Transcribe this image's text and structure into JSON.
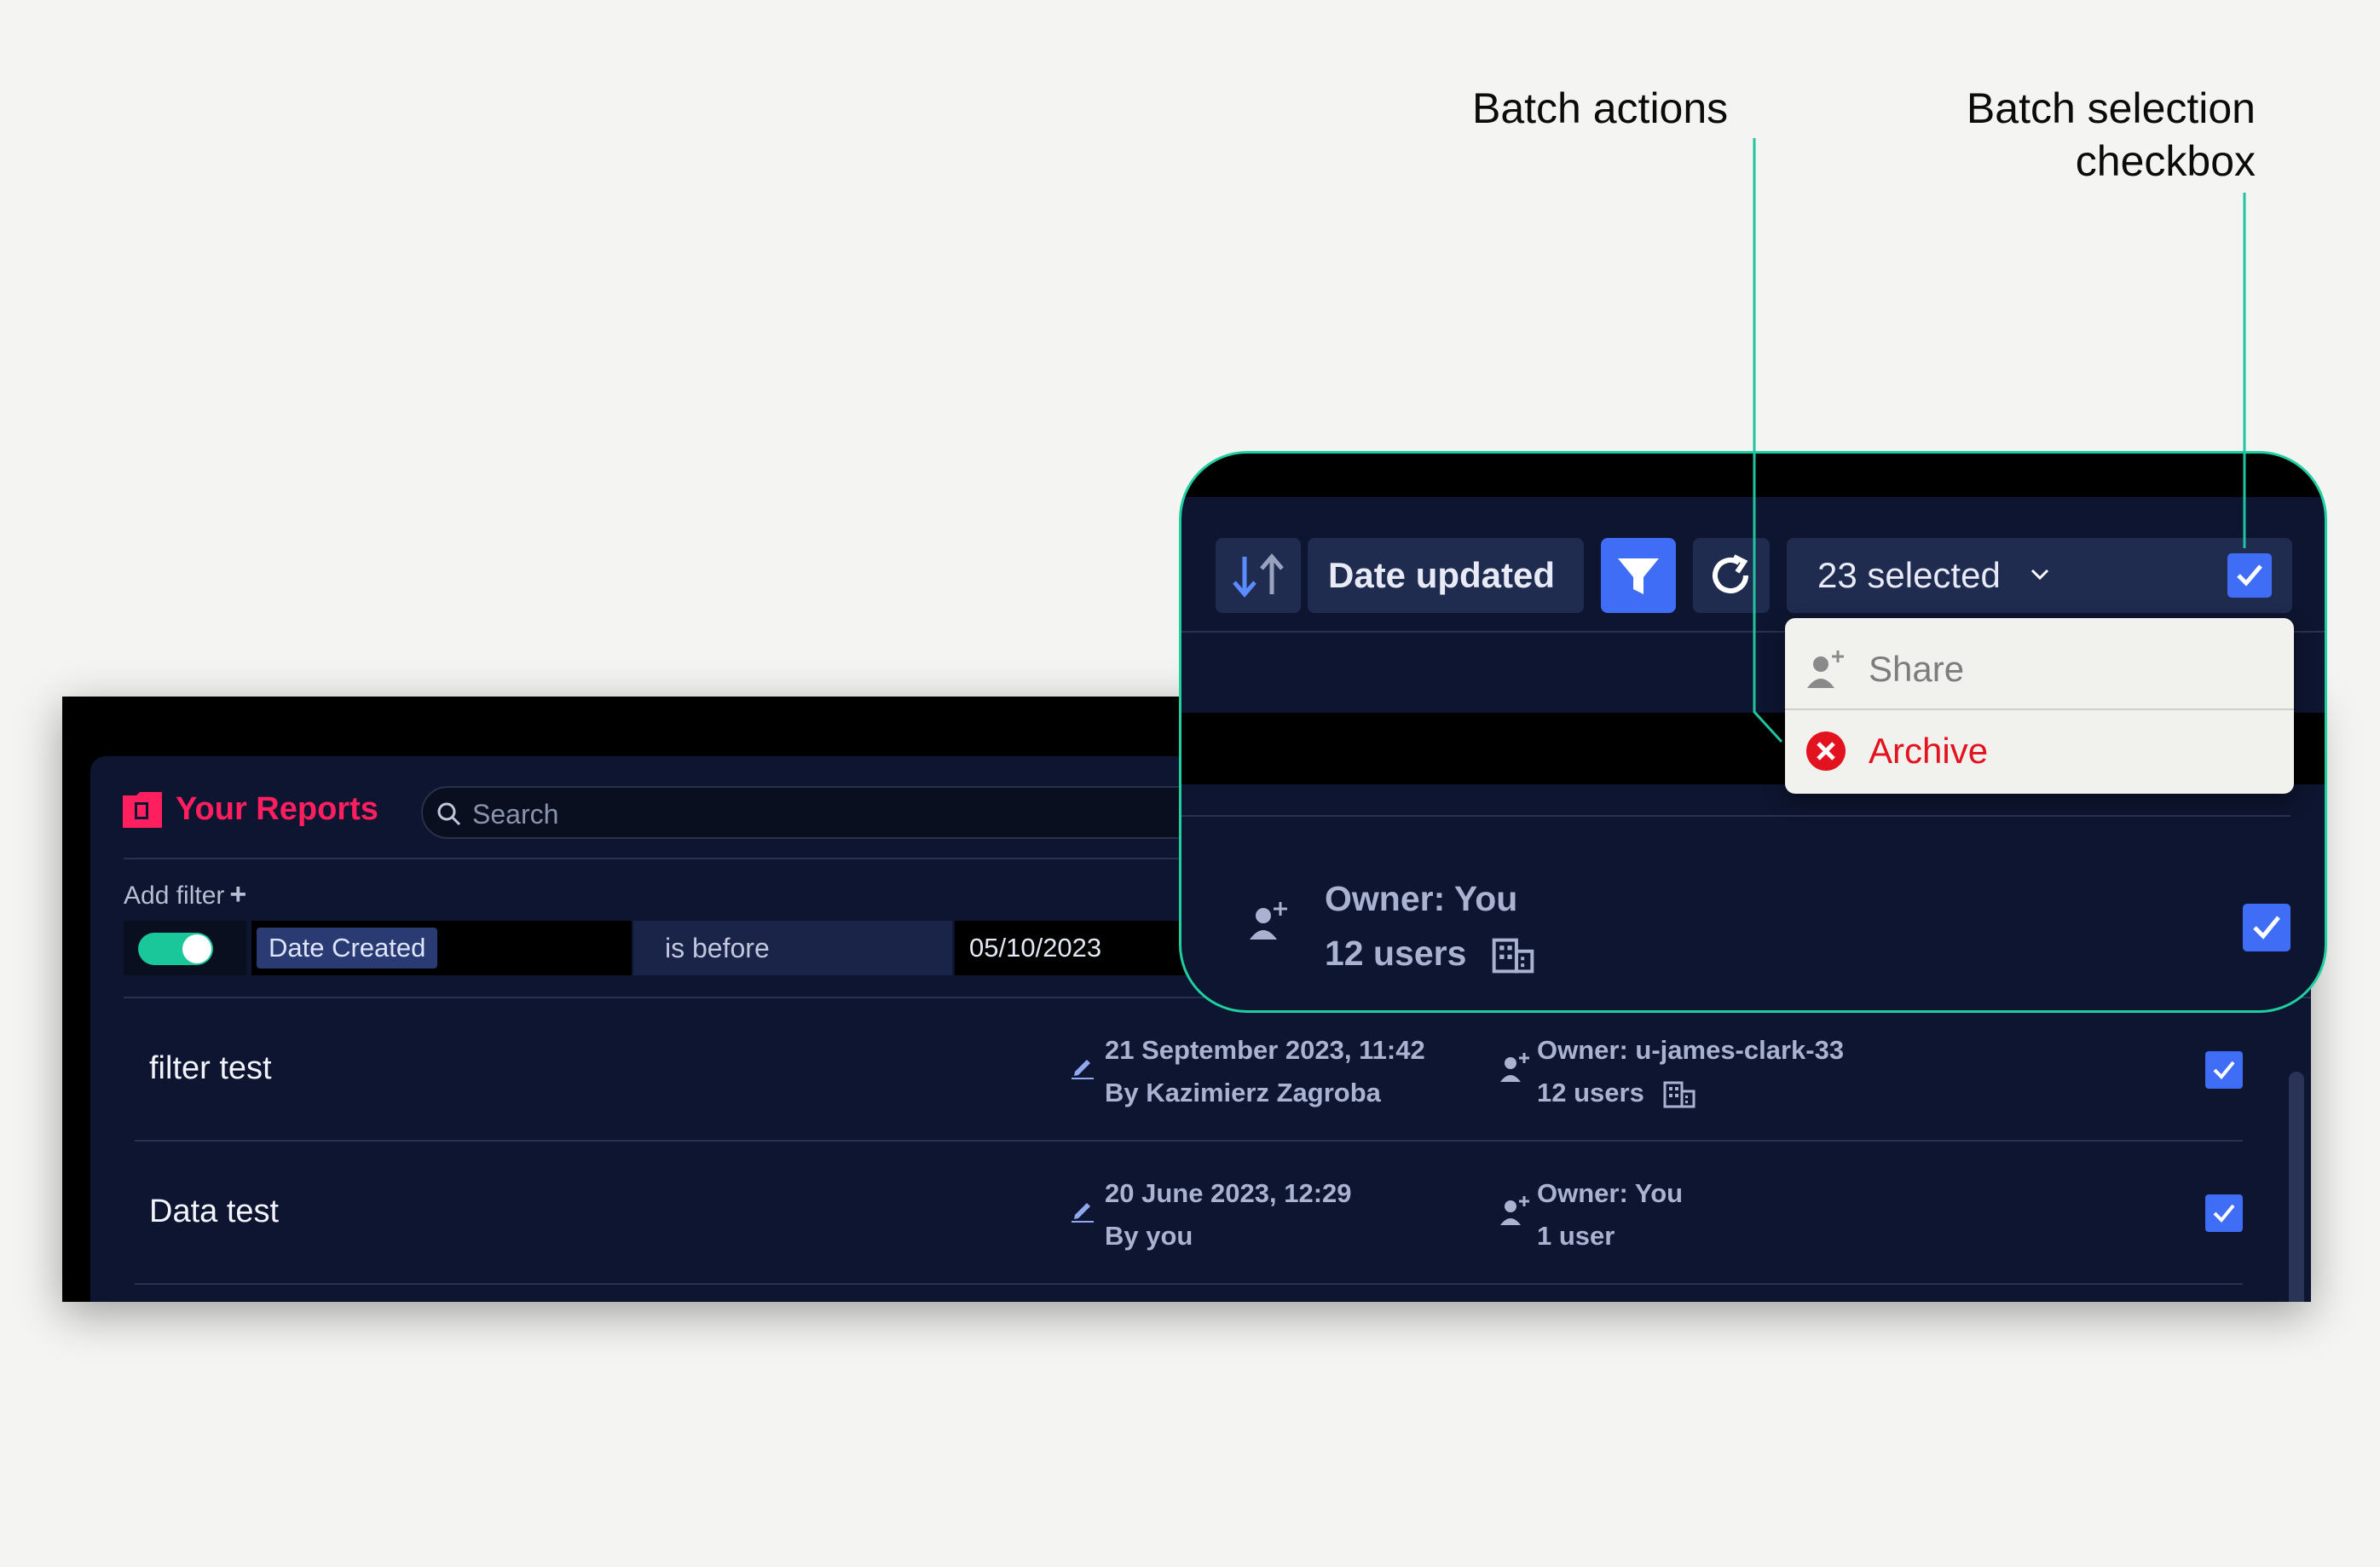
{
  "annotations": {
    "batch_actions": "Batch actions",
    "batch_selection_line1": "Batch selection",
    "batch_selection_line2": "checkbox"
  },
  "header": {
    "title": "Your Reports",
    "search_placeholder": "Search"
  },
  "filters": {
    "add_filter_label": "Add filter",
    "add_filter_plus": "+",
    "active": true,
    "field": "Date Created",
    "operator": "is before",
    "value": "05/10/2023"
  },
  "toolbar": {
    "sort_label": "Date updated",
    "selected_label": "23 selected"
  },
  "batch_menu": {
    "items": [
      {
        "label": "Share",
        "icon": "share-user-icon"
      },
      {
        "label": "Archive",
        "icon": "archive-x-icon",
        "color": "#e3121f"
      }
    ]
  },
  "zoom_row": {
    "owner": "Owner: You",
    "users": "12 users"
  },
  "reports": [
    {
      "name": "filter test",
      "date": "21 September 2023, 11:42",
      "by": "By Kazimierz Zagroba",
      "owner": "Owner: u-james-clark-33",
      "users": "12 users",
      "org_shared": true,
      "selected": true
    },
    {
      "name": "Data test",
      "date": "20 June 2023, 12:29",
      "by": "By you",
      "owner": "Owner: You",
      "users": "1 user",
      "org_shared": false,
      "selected": true
    }
  ],
  "colors": {
    "accent": "#3f6df6",
    "brand": "#ff1f5f",
    "callout": "#1fcf9f",
    "toggle_on": "#19c79a",
    "panel_bg": "#0e1530"
  }
}
